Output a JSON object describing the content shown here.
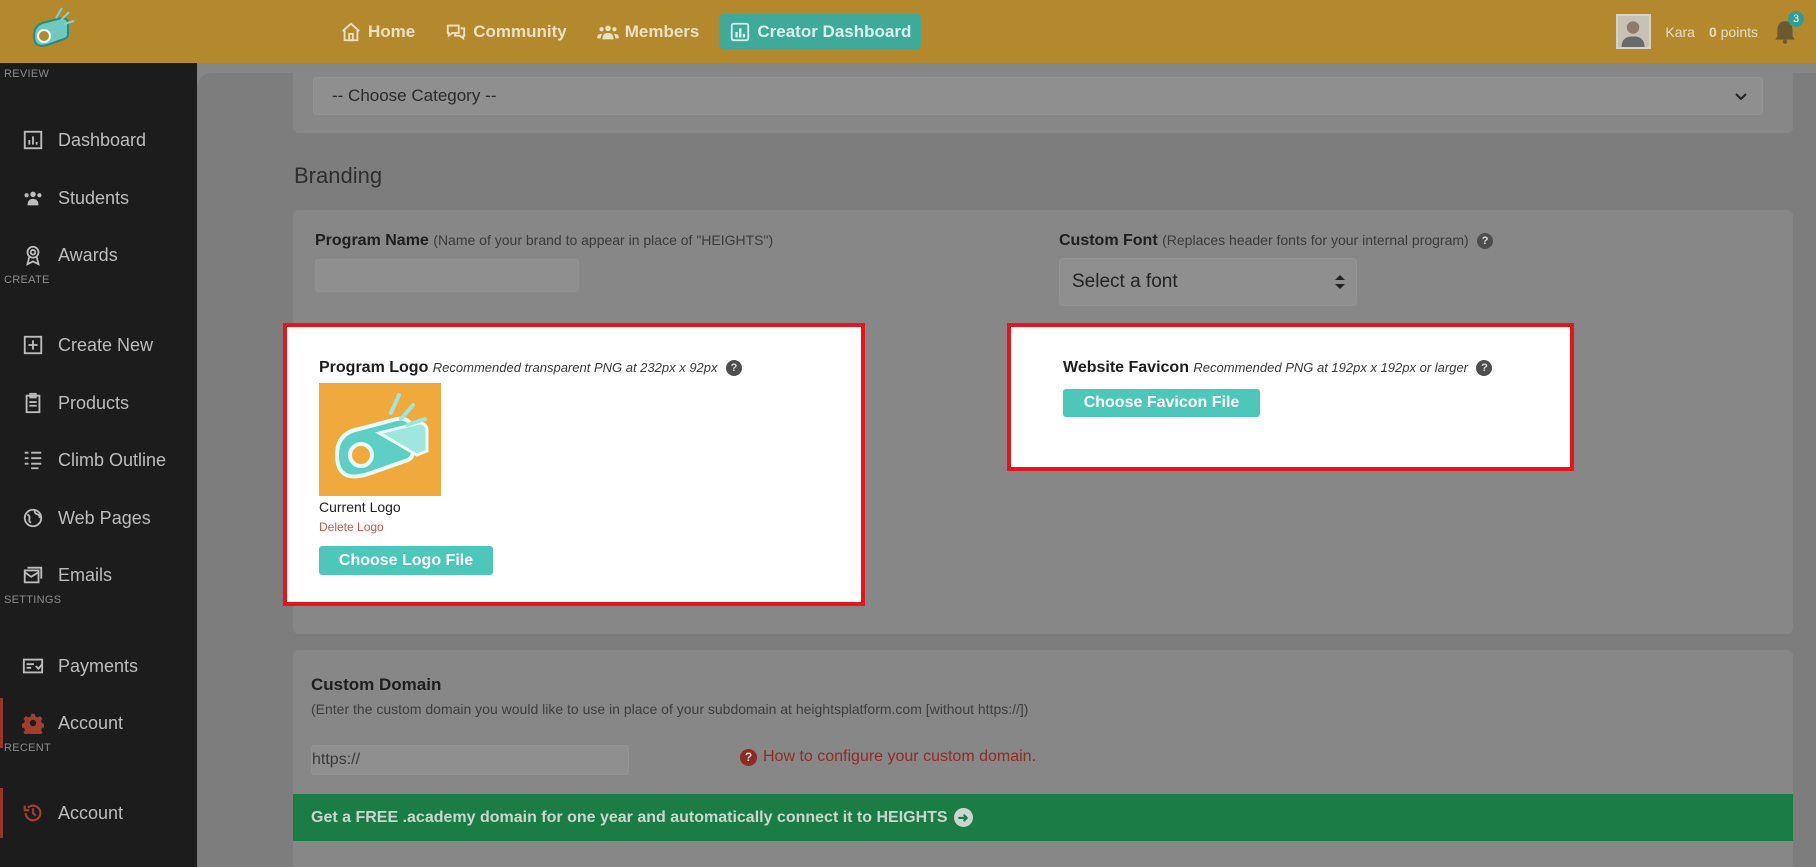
{
  "topnav": {
    "items": [
      {
        "label": "Home",
        "icon": "home-icon"
      },
      {
        "label": "Community",
        "icon": "chat-icon"
      },
      {
        "label": "Members",
        "icon": "users-icon"
      },
      {
        "label": "Creator Dashboard",
        "icon": "chart-icon",
        "active": true
      }
    ],
    "user_name": "Kara",
    "points_value": "0",
    "points_label": "points",
    "notification_count": "3"
  },
  "sidebar": {
    "section_review": "REVIEW",
    "section_create": "CREATE",
    "section_settings": "SETTINGS",
    "section_recent": "RECENT",
    "items": [
      {
        "label": "Dashboard"
      },
      {
        "label": "Students"
      },
      {
        "label": "Awards"
      },
      {
        "label": "Create New"
      },
      {
        "label": "Products"
      },
      {
        "label": "Climb Outline"
      },
      {
        "label": "Web Pages"
      },
      {
        "label": "Emails"
      },
      {
        "label": "Payments"
      },
      {
        "label": "Account"
      },
      {
        "label": "Account"
      }
    ]
  },
  "category": {
    "placeholder": "-- Choose Category --"
  },
  "branding": {
    "heading": "Branding",
    "program_name_label": "Program Name",
    "program_name_note": "(Name of your brand to appear in place of \"HEIGHTS\")",
    "program_name_value": "",
    "custom_font_label": "Custom Font",
    "custom_font_note": "(Replaces header fonts for your internal program)",
    "font_select_value": "Select a font",
    "help_glyph": "?",
    "program_logo_label": "Program Logo",
    "program_logo_note": "Recommended transparent PNG at 232px x 92px",
    "current_logo": "Current Logo",
    "delete_logo": "Delete Logo",
    "choose_logo": "Choose Logo File",
    "favicon_label": "Website Favicon",
    "favicon_note": "Recommended PNG at 192px x 192px or larger",
    "choose_favicon": "Choose Favicon File"
  },
  "domain": {
    "title": "Custom Domain",
    "subtitle": "(Enter the custom domain you would like to use in place of your subdomain at heightsplatform.com [without https://])",
    "prefix": "https://",
    "help_link": "How to configure your custom domain.",
    "help_glyph": "?",
    "promo": "Get a FREE .academy domain for one year and automatically connect it to HEIGHTS",
    "promo_arrow": "➜"
  },
  "colors": {
    "topbar": "#b4892e",
    "teal_button": "#4ec7bb",
    "highlight_border": "#e8131b",
    "promo_green": "#1c7c45"
  }
}
